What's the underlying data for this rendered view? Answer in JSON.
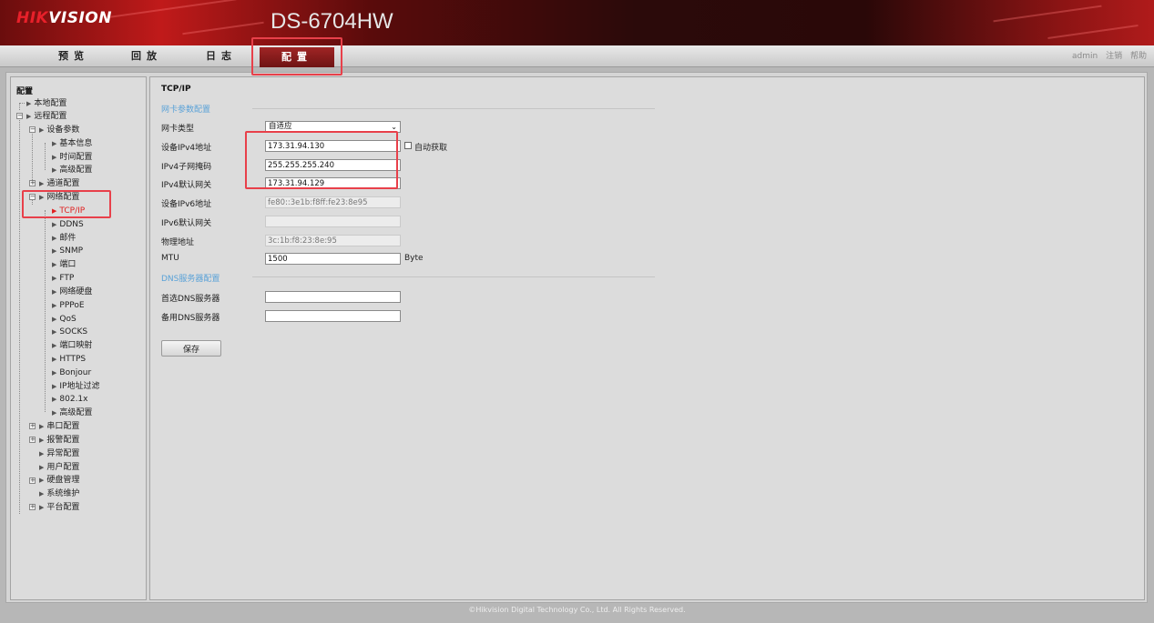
{
  "header": {
    "logo_hik": "HIK",
    "logo_vision": "VISION",
    "model": "DS-6704HW"
  },
  "nav": {
    "tabs": [
      {
        "label": "预览"
      },
      {
        "label": "回放"
      },
      {
        "label": "日志"
      },
      {
        "label": "配置"
      }
    ],
    "active": "配置",
    "user": {
      "name": "admin",
      "logout": "注销",
      "help": "帮助"
    }
  },
  "sidebar": {
    "title": "配置",
    "items": [
      {
        "label": "本地配置"
      },
      {
        "label": "远程配置"
      },
      {
        "label": "设备参数"
      },
      {
        "label": "基本信息"
      },
      {
        "label": "时间配置"
      },
      {
        "label": "高级配置"
      },
      {
        "label": "通道配置"
      },
      {
        "label": "网络配置"
      },
      {
        "label": "TCP/IP"
      },
      {
        "label": "DDNS"
      },
      {
        "label": "邮件"
      },
      {
        "label": "SNMP"
      },
      {
        "label": "端口"
      },
      {
        "label": "FTP"
      },
      {
        "label": "网络硬盘"
      },
      {
        "label": "PPPoE"
      },
      {
        "label": "QoS"
      },
      {
        "label": "SOCKS"
      },
      {
        "label": "端口映射"
      },
      {
        "label": "HTTPS"
      },
      {
        "label": "Bonjour"
      },
      {
        "label": "IP地址过滤"
      },
      {
        "label": "802.1x"
      },
      {
        "label": "高级配置"
      },
      {
        "label": "串口配置"
      },
      {
        "label": "报警配置"
      },
      {
        "label": "异常配置"
      },
      {
        "label": "用户配置"
      },
      {
        "label": "硬盘管理"
      },
      {
        "label": "系统维护"
      },
      {
        "label": "平台配置"
      }
    ],
    "selected": "TCP/IP"
  },
  "main": {
    "title": "TCP/IP",
    "nic_group": "网卡参数配置",
    "nic_type_label": "网卡类型",
    "nic_type_value": "自适应",
    "ipv4_label": "设备IPv4地址",
    "ipv4_value": "173.31.94.130",
    "auto_label": "自动获取",
    "auto_checked": false,
    "mask_label": "IPv4子网掩码",
    "mask_value": "255.255.255.240",
    "gw_label": "IPv4默认网关",
    "gw_value": "173.31.94.129",
    "ipv6_label": "设备IPv6地址",
    "ipv6_value": "fe80::3e1b:f8ff:fe23:8e95",
    "ipv6gw_label": "IPv6默认网关",
    "ipv6gw_value": "",
    "mac_label": "物理地址",
    "mac_value": "3c:1b:f8:23:8e:95",
    "mtu_label": "MTU",
    "mtu_value": "1500",
    "mtu_unit": "Byte",
    "dns_group": "DNS服务器配置",
    "dns1_label": "首选DNS服务器",
    "dns1_value": "",
    "dns2_label": "备用DNS服务器",
    "dns2_value": "",
    "save_label": "保存"
  },
  "footer": {
    "copyright": "©Hikvision Digital Technology Co., Ltd. All Rights Reserved."
  },
  "colors": {
    "accent_red": "#e8404a",
    "selected_text": "#e02020",
    "group_blue": "#5aa2d8",
    "header_red": "#c01a1a"
  }
}
